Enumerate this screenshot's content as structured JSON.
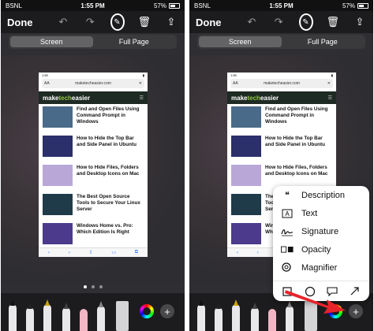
{
  "status": {
    "carrier": "BSNL",
    "time": "1:55 PM",
    "battery": "57%"
  },
  "toolbar": {
    "done_label": "Done"
  },
  "segments": {
    "screen": "Screen",
    "full_page": "Full Page"
  },
  "page": {
    "time": "1:55",
    "url": "maketecheasier.com",
    "aa": "AA",
    "logo_a": "make",
    "logo_b": "tech",
    "logo_c": "easier",
    "articles": [
      {
        "title": "Find and Open Files Using Command Prompt in Windows",
        "color": "#4a6a8a"
      },
      {
        "title": "How to Hide the Top Bar and Side Panel in Ubuntu",
        "color": "#2b2f6a"
      },
      {
        "title": "How to Hide Files, Folders and Desktop Icons on Mac",
        "color": "#b9a7d8"
      },
      {
        "title": "The Best Open Source Tools to Secure Your Linux Server",
        "color": "#1f3b4a"
      },
      {
        "title": "Windows Home vs. Pro: Which Edition Is Right",
        "color": "#4c3a8c"
      }
    ]
  },
  "popup": {
    "items": [
      {
        "label": "Description",
        "icon": "quote-icon"
      },
      {
        "label": "Text",
        "icon": "text-box-icon"
      },
      {
        "label": "Signature",
        "icon": "signature-icon"
      },
      {
        "label": "Opacity",
        "icon": "opacity-icon"
      },
      {
        "label": "Magnifier",
        "icon": "magnifier-icon"
      }
    ],
    "shapes": [
      "square-shape-icon",
      "circle-shape-icon",
      "speech-bubble-icon",
      "arrow-shape-icon"
    ]
  },
  "colors": {
    "accent_red": "#e8232a",
    "link_blue": "#3478f6"
  }
}
